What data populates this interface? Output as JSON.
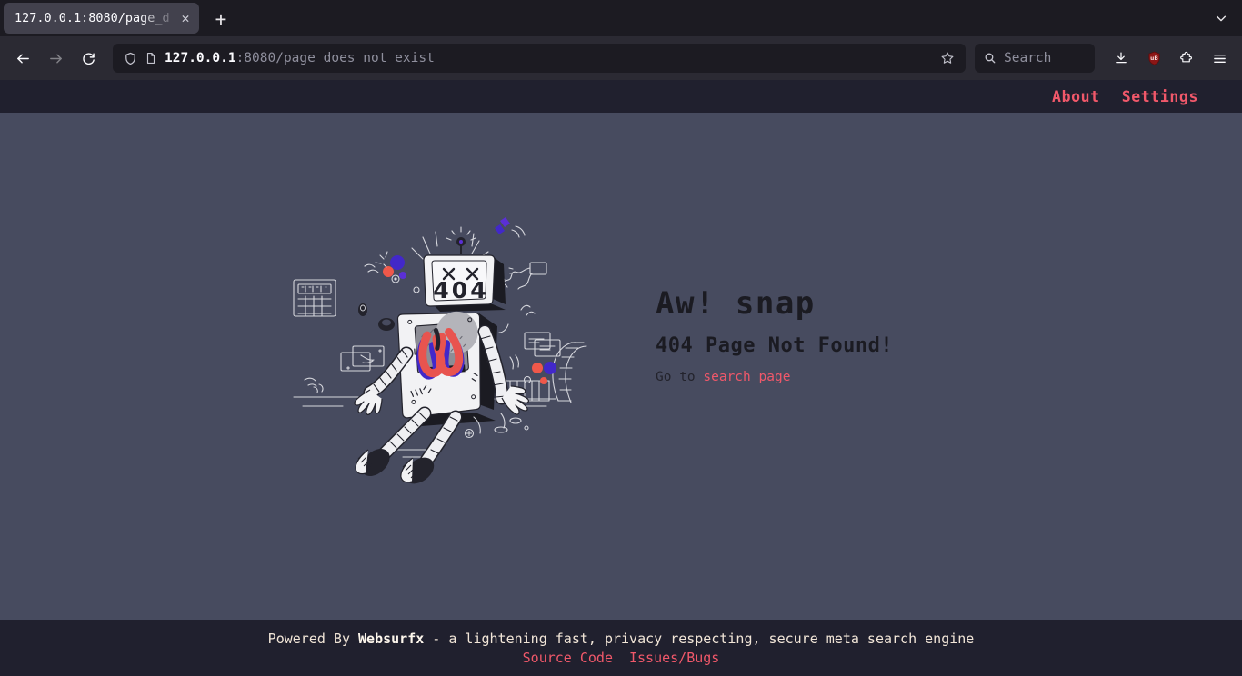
{
  "browser": {
    "tab": {
      "title": "127.0.0.1:8080/page_d",
      "close_label": "✕"
    },
    "newtab_label": "+",
    "url": {
      "host": "127.0.0.1",
      "rest": ":8080/page_does_not_exist",
      "full": "127.0.0.1:8080/page_does_not_exist"
    },
    "search": {
      "placeholder": "Search"
    },
    "icons": {
      "back": "back-arrow-icon",
      "forward": "forward-arrow-icon",
      "reload": "reload-icon",
      "shield": "tracking-protection-shield-icon",
      "page": "page-document-icon",
      "bookmark": "bookmark-star-icon",
      "search": "search-magnifier-icon",
      "downloads": "downloads-icon",
      "ublock": "ublock-origin-icon",
      "extensions": "extensions-puzzle-icon",
      "menu": "hamburger-menu-icon",
      "tablist": "tab-list-chevron-down-icon"
    },
    "ublock_label": "uB"
  },
  "site": {
    "nav": [
      {
        "label": "About"
      },
      {
        "label": "Settings"
      }
    ],
    "error": {
      "title": "Aw! snap",
      "subtitle": "404 Page Not Found!",
      "goto_prefix": "Go to ",
      "goto_link": "search page"
    },
    "illustration": {
      "name": "broken-robot-404-illustration",
      "head_text": "404"
    },
    "footer": {
      "powered_prefix": "Powered By ",
      "brand": "Websurfx",
      "tagline": " - a lightening fast, privacy respecting, secure meta search engine",
      "links": [
        {
          "label": "Source Code"
        },
        {
          "label": "Issues/Bugs"
        }
      ]
    }
  },
  "colors": {
    "page_bg": "#474b5f",
    "bar_bg": "#20202e",
    "accent_pink": "#f0586a",
    "footer_text": "#f2e6d8",
    "heading": "#1b1b22",
    "chrome_tabstrip": "#1c1b22",
    "chrome_navbar": "#2b2a33",
    "tab_active": "#42414d"
  }
}
